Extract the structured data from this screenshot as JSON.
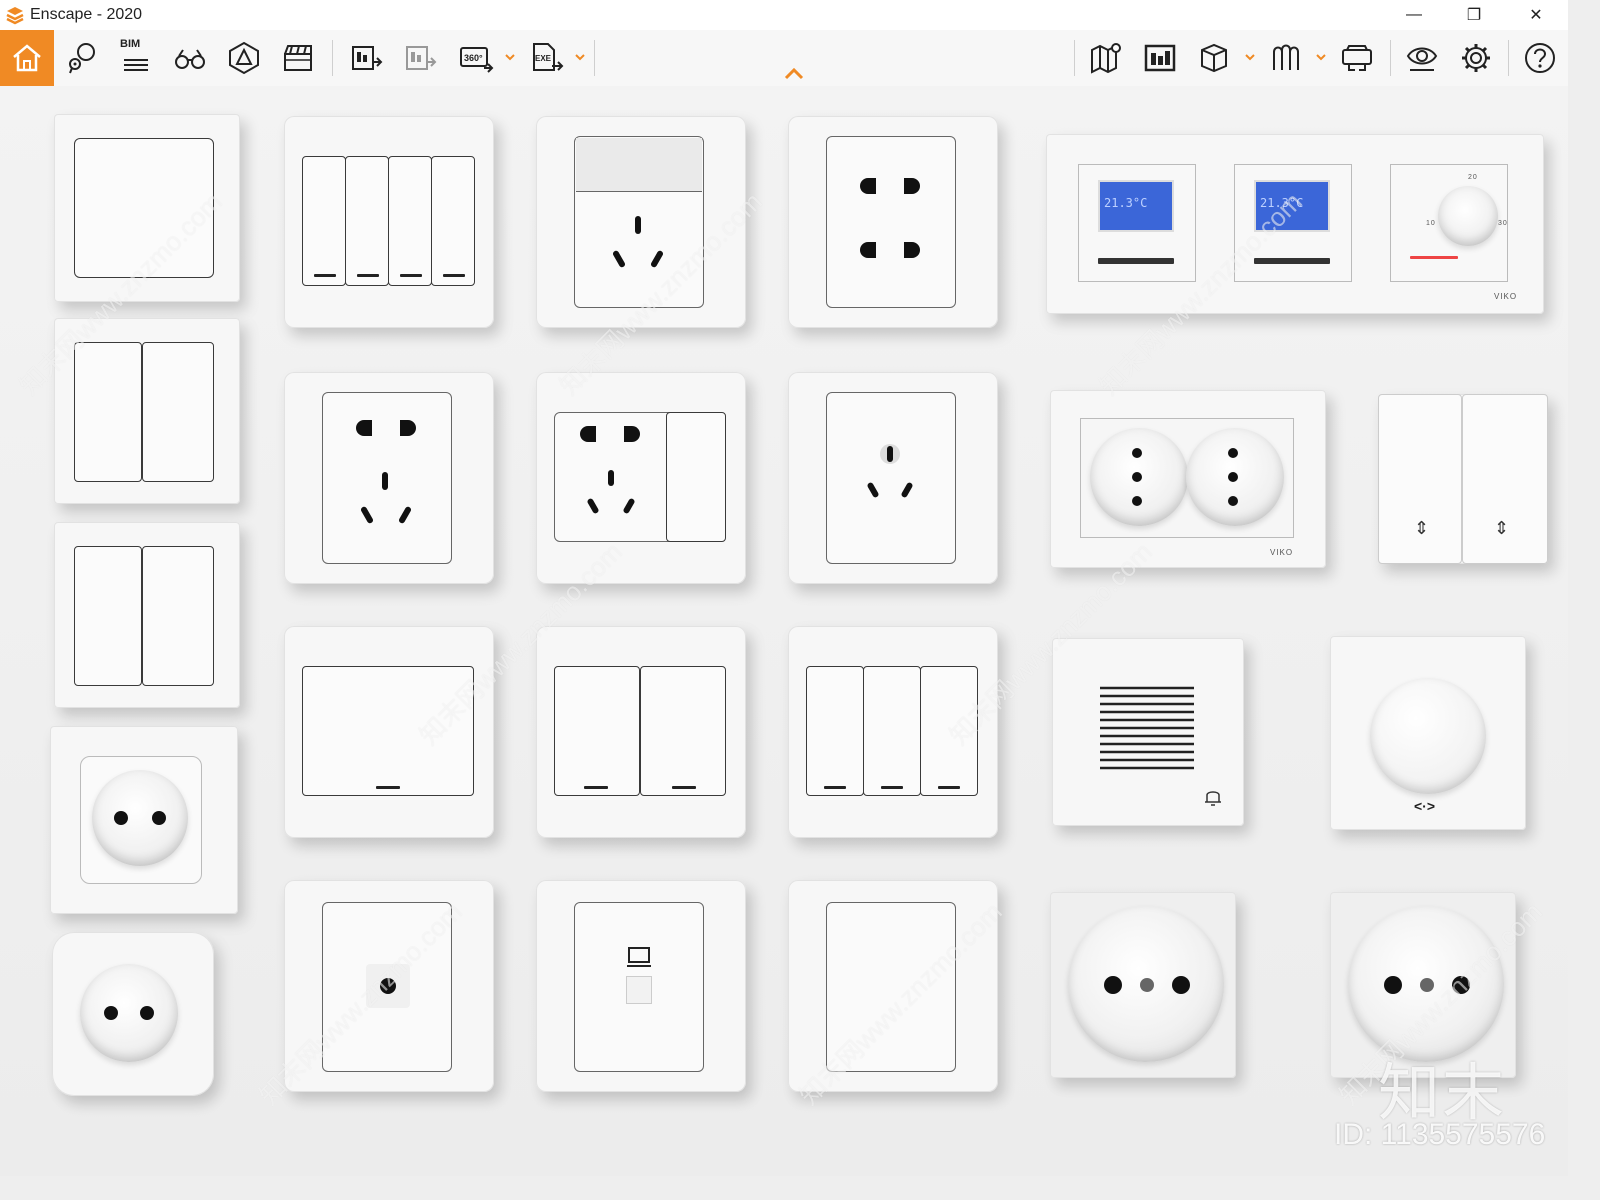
{
  "window": {
    "title": "Enscape - 2020",
    "minimize_glyph": "—",
    "restore_glyph": "❐",
    "close_glyph": "✕"
  },
  "toolbar": {
    "left_buttons": [
      "home-icon",
      "pin-balloon-icon",
      "bim-icon",
      "binoculars-icon",
      "asset-library-icon",
      "clapperboard-icon",
      "batch-render-icon",
      "render-pdf-icon",
      "panorama-360-icon",
      "export-exe-icon"
    ],
    "right_buttons": [
      "map-icon",
      "screenshot-icon",
      "cube-view-icon",
      "atmosphere-icon",
      "vr-headset-icon",
      "visual-settings-icon",
      "settings-gear-icon",
      "help-icon"
    ],
    "bim_label": "BIM",
    "panorama_label": "360°",
    "exe_label": "EXE",
    "accent_color": "#f08a24"
  },
  "scene": {
    "thermostat_lcd_1": "21.3°C",
    "thermostat_lcd_2": "21.3°C",
    "thermostat_brand": "VIKO",
    "schuko_brand": "VIKO",
    "dial_label_top": "20",
    "dial_label_left": "10",
    "dial_label_right": "30",
    "dimmer_arrows": "<·>",
    "shutter_arrow_1": "⇕",
    "shutter_arrow_2": "⇕"
  },
  "watermark": {
    "logo_text": "知末",
    "id_text": "ID: 1135575576",
    "diagonal_text": "知末网www.znzmo.com"
  }
}
